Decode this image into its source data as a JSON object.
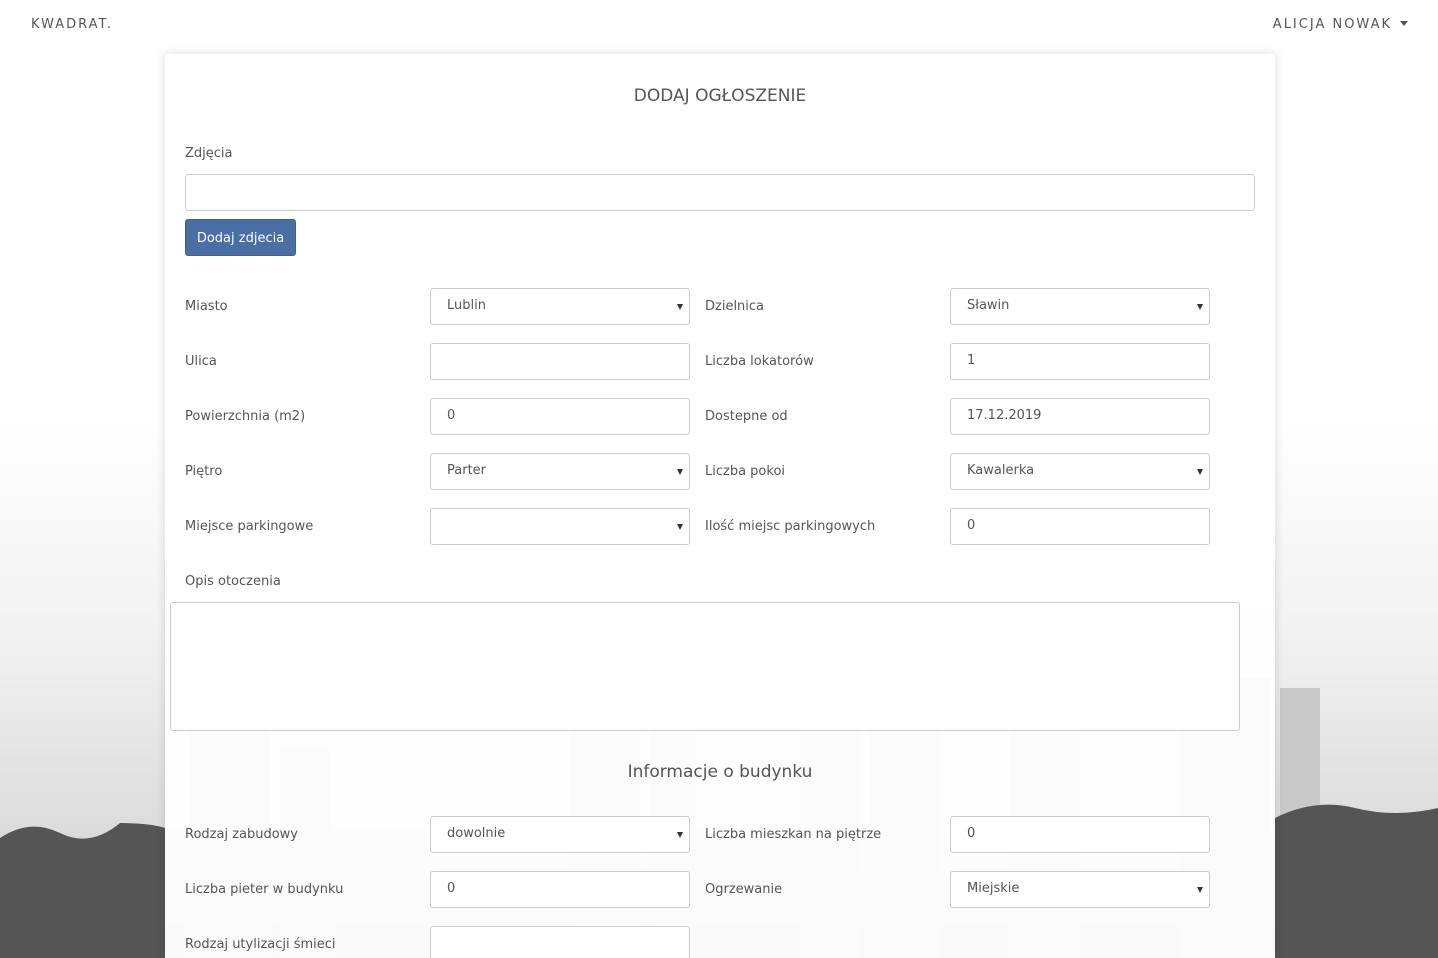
{
  "nav": {
    "brand": "KWADRAT.",
    "user": "ALICJA NOWAK"
  },
  "title": "DODAJ OGŁOSZENIE",
  "photos": {
    "label": "Zdjęcia",
    "value": "",
    "button": "Dodaj zdjecia"
  },
  "fields": [
    {
      "label": "Miasto",
      "value": "Lublin",
      "select": true
    },
    {
      "label": "Dzielnica",
      "value": "Sławin",
      "select": true
    },
    {
      "label": "Ulica",
      "value": "",
      "select": false
    },
    {
      "label": "Liczba lokatorów",
      "value": "1",
      "select": false
    },
    {
      "label": "Powierzchnia (m2)",
      "value": "0",
      "select": false
    },
    {
      "label": "Dostepne od",
      "value": "17.12.2019",
      "select": false
    },
    {
      "label": "Piętro",
      "value": "Parter",
      "select": true
    },
    {
      "label": "Liczba pokoi",
      "value": "Kawalerka",
      "select": true
    },
    {
      "label": "Miejsce parkingowe",
      "value": "",
      "select": true
    },
    {
      "label": "Ilość miejsc parkingowych",
      "value": "0",
      "select": false
    }
  ],
  "description": {
    "label": "Opis otoczenia",
    "value": ""
  },
  "building_title": "Informacje o budynku",
  "building_fields": [
    {
      "label": "Rodzaj zabudowy",
      "value": "dowolnie",
      "select": true
    },
    {
      "label": "Liczba mieszkan na piętrze",
      "value": "0",
      "select": false
    },
    {
      "label": "Liczba pieter w budynku",
      "value": "0",
      "select": false
    },
    {
      "label": "Ogrzewanie",
      "value": "Miejskie",
      "select": true
    },
    {
      "label": "Rodzaj utylizacji śmieci",
      "value": "",
      "select": false
    }
  ]
}
